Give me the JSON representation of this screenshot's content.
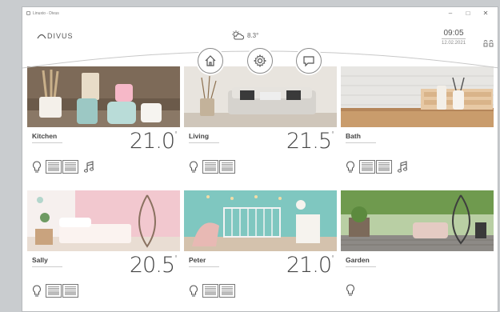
{
  "window": {
    "title": "Linuxio - Divus",
    "controls": [
      "–",
      "□",
      "✕"
    ]
  },
  "header": {
    "logo_text": "DIVUS",
    "weather": {
      "icon": "sun-cloud-icon",
      "temperature": "8.3°"
    },
    "time": "09:05",
    "date": "12.02.2021"
  },
  "nav": [
    {
      "icon": "home-icon"
    },
    {
      "icon": "gear-icon"
    },
    {
      "icon": "chat-icon"
    }
  ],
  "rooms": [
    {
      "name": "Kitchen",
      "temperature": "21.0",
      "unit": "°",
      "controls": [
        "bulb-icon",
        "blinds",
        "music-icon"
      ]
    },
    {
      "name": "Living",
      "temperature": "21.5",
      "unit": "°",
      "controls": [
        "bulb-icon",
        "blinds"
      ]
    },
    {
      "name": "Bath",
      "temperature": "",
      "unit": "",
      "controls": [
        "bulb-icon",
        "blinds",
        "music-icon"
      ]
    },
    {
      "name": "Sally",
      "temperature": "20.5",
      "unit": "°",
      "controls": [
        "bulb-icon",
        "blinds"
      ]
    },
    {
      "name": "Peter",
      "temperature": "21.0",
      "unit": "°",
      "controls": [
        "bulb-icon",
        "blinds"
      ]
    },
    {
      "name": "Garden",
      "temperature": "",
      "unit": "",
      "controls": [
        "bulb-icon"
      ]
    }
  ]
}
